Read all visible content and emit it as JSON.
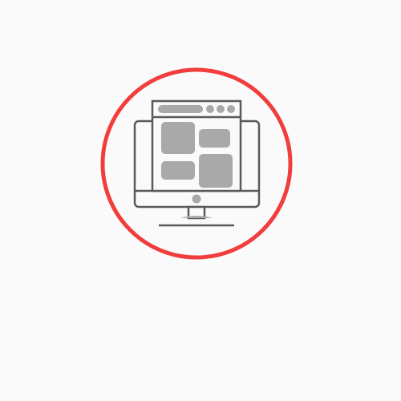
{
  "illustration": {
    "icon": "desktop-monitor-webpage-layout-icon",
    "ring_color": "#f23d3d",
    "outline_color": "#5a5a5a",
    "block_color": "#a9a9a9",
    "background_color": "#fafafa"
  }
}
